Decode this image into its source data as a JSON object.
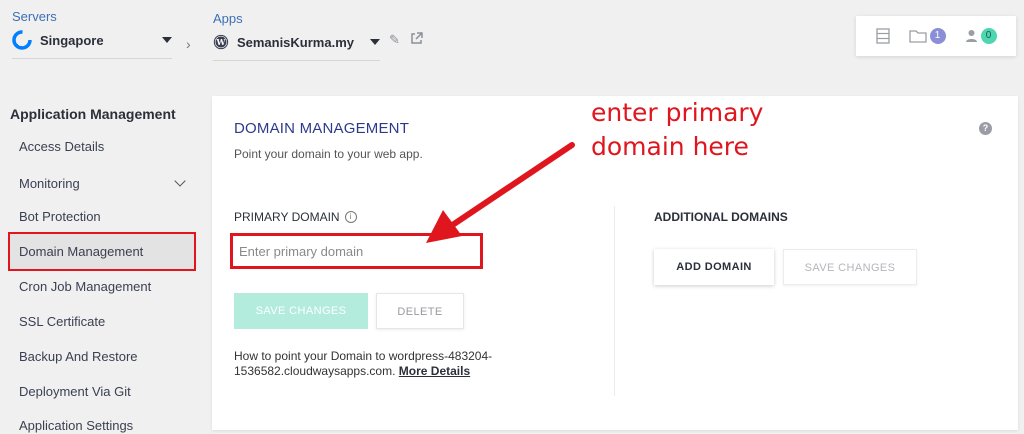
{
  "header": {
    "servers_label": "Servers",
    "server_name": "Singapore",
    "apps_label": "Apps",
    "app_name": "SemanisKurma.my",
    "counts": {
      "folders": "1",
      "members": "0"
    }
  },
  "sidebar": {
    "title": "Application Management",
    "items": [
      {
        "label": "Access Details"
      },
      {
        "label": "Monitoring"
      },
      {
        "label": "Bot Protection"
      },
      {
        "label": "Domain Management"
      },
      {
        "label": "Cron Job Management"
      },
      {
        "label": "SSL Certificate"
      },
      {
        "label": "Backup And Restore"
      },
      {
        "label": "Deployment Via Git"
      },
      {
        "label": "Application Settings"
      }
    ]
  },
  "main": {
    "title": "DOMAIN MANAGEMENT",
    "subtitle": "Point your domain to your web app.",
    "primary_label": "PRIMARY DOMAIN",
    "primary_placeholder": "Enter primary domain",
    "save_label": "SAVE CHANGES",
    "delete_label": "DELETE",
    "howto_text": "How to point your Domain to wordpress-483204-1536582.cloudwaysapps.com.",
    "more_details": "More Details",
    "additional_label": "ADDITIONAL DOMAINS",
    "add_domain_label": "ADD DOMAIN",
    "save2_label": "SAVE CHANGES"
  },
  "annotation": {
    "text": "enter primary domain here",
    "color": "#e0161e"
  },
  "colors": {
    "brand_blue": "#2d3a8c",
    "accent_green": "#b3ecdc",
    "highlight_red": "#e0161e"
  }
}
